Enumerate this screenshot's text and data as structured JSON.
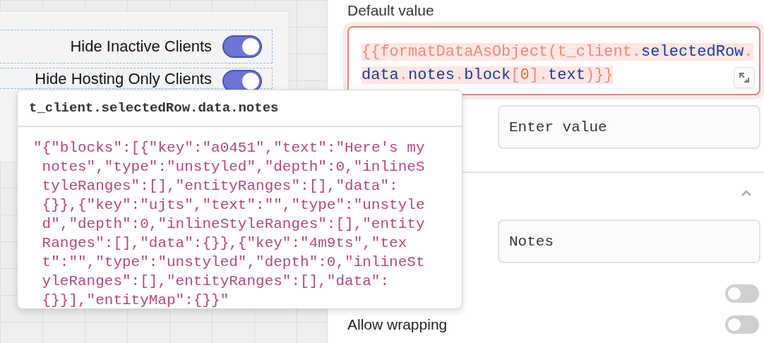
{
  "canvas": {
    "toggles": [
      {
        "label": "Hide Inactive Clients",
        "on": true
      },
      {
        "label": "Hide Hosting Only Clients",
        "on": true
      }
    ]
  },
  "property_pane": {
    "default_value": {
      "label": "Default value",
      "tokens": [
        {
          "kind": "binding",
          "text": "{{formatDataAsObject(t_client."
        },
        {
          "kind": "prop",
          "text": "selectedRow"
        },
        {
          "kind": "binding",
          "text": "."
        },
        {
          "kind": "prop",
          "text": "data"
        },
        {
          "kind": "binding",
          "text": "."
        },
        {
          "kind": "prop",
          "text": "notes"
        },
        {
          "kind": "binding",
          "text": "."
        },
        {
          "kind": "prop",
          "text": "block"
        },
        {
          "kind": "binding",
          "text": "["
        },
        {
          "kind": "number",
          "text": "0"
        },
        {
          "kind": "binding",
          "text": "]."
        },
        {
          "kind": "prop",
          "text": "text"
        },
        {
          "kind": "binding",
          "text": ")}}"
        }
      ]
    },
    "value_field": {
      "value": "Enter value"
    },
    "section": {
      "expanded": true
    },
    "name_field": {
      "value": "Notes"
    },
    "switches": [
      {
        "on": false
      },
      {
        "label": "Allow wrapping",
        "on": false
      }
    ]
  },
  "popover": {
    "title": "t_client.selectedRow.data.notes",
    "value": "\"{\"blocks\":[{\"key\":\"a0451\",\"text\":\"Here's my notes\",\"type\":\"unstyled\",\"depth\":0,\"inlineStyleRanges\":[],\"entityRanges\":[],\"data\":{}},{\"key\":\"ujts\",\"text\":\"\",\"type\":\"unstyled\",\"depth\":0,\"inlineStyleRanges\":[],\"entityRanges\":[],\"data\":{}},{\"key\":\"4m9ts\",\"text\":\"\",\"type\":\"unstyled\",\"depth\":0,\"inlineStyleRanges\":[],\"entityRanges\":[],\"data\":{}}],\"entityMap\":{}}\""
  }
}
